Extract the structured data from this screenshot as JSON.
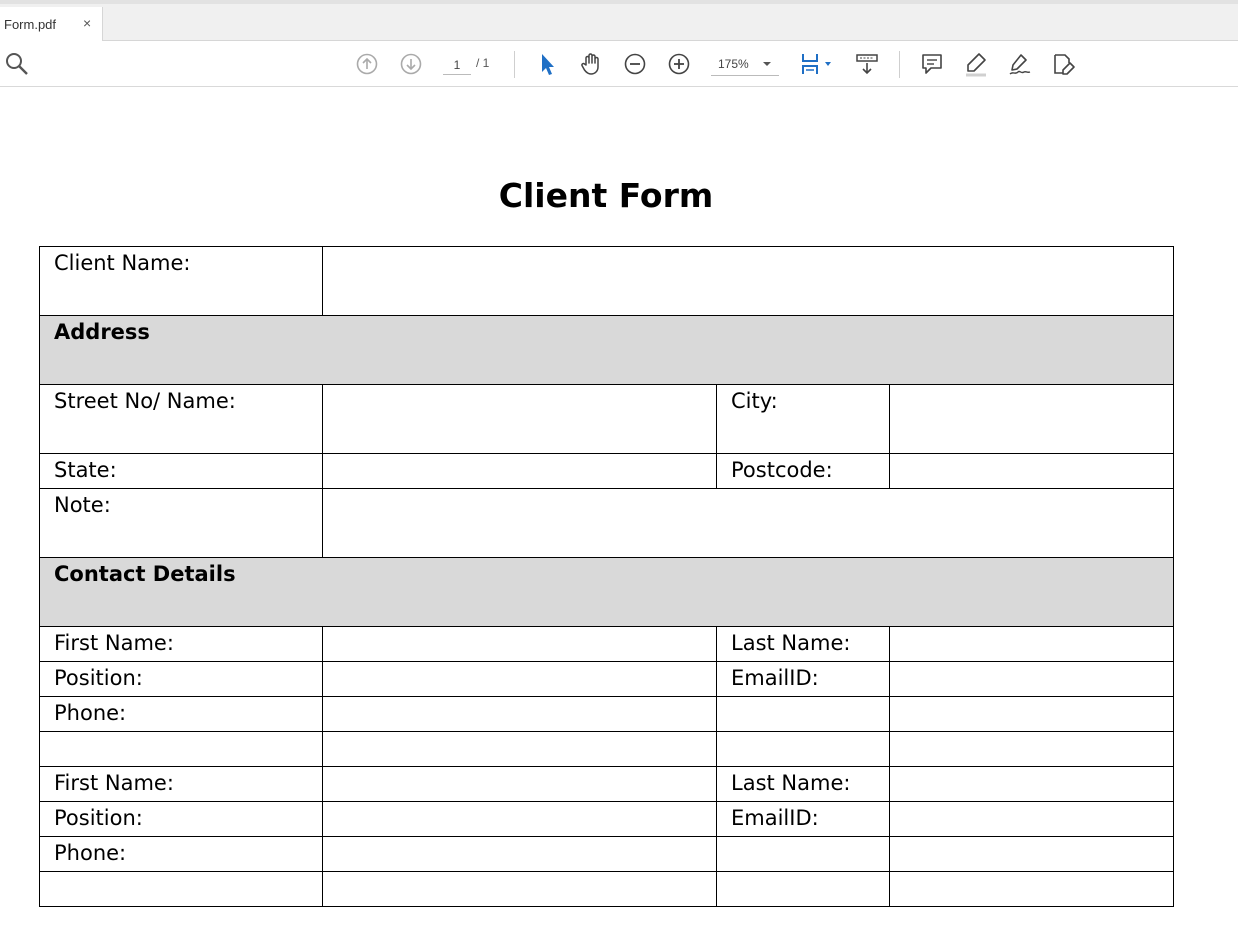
{
  "tab": {
    "title": "Form.pdf",
    "close": "×"
  },
  "toolbar": {
    "page_current": "1",
    "page_total": "/ 1",
    "zoom": "175%",
    "icons": [
      "search-icon",
      "prev-page-icon",
      "next-page-icon",
      "select-cursor-icon",
      "hand-tool-icon",
      "zoom-out-icon",
      "zoom-in-icon",
      "fit-page-icon",
      "scroll-mode-icon",
      "comment-icon",
      "highlight-icon",
      "sign-icon",
      "fill-sign-icon"
    ],
    "accent_color": "#1f6fc5"
  },
  "document": {
    "title": "Client Form",
    "client_name_label": "Client Name:",
    "address_header": "Address",
    "street_label": "Street No/ Name:",
    "city_label": "City:",
    "state_label": "State:",
    "postcode_label": "Postcode:",
    "note_label": "Note:",
    "contact_header": "Contact Details",
    "contacts": [
      {
        "first_name_label": "First Name:",
        "last_name_label": "Last Name:",
        "position_label": "Position:",
        "email_label": "EmailID:",
        "phone_label": "Phone:"
      },
      {
        "first_name_label": "First Name:",
        "last_name_label": "Last Name:",
        "position_label": "Position:",
        "email_label": "EmailID:",
        "phone_label": "Phone:"
      }
    ],
    "section_color": "#d9d9d9"
  }
}
